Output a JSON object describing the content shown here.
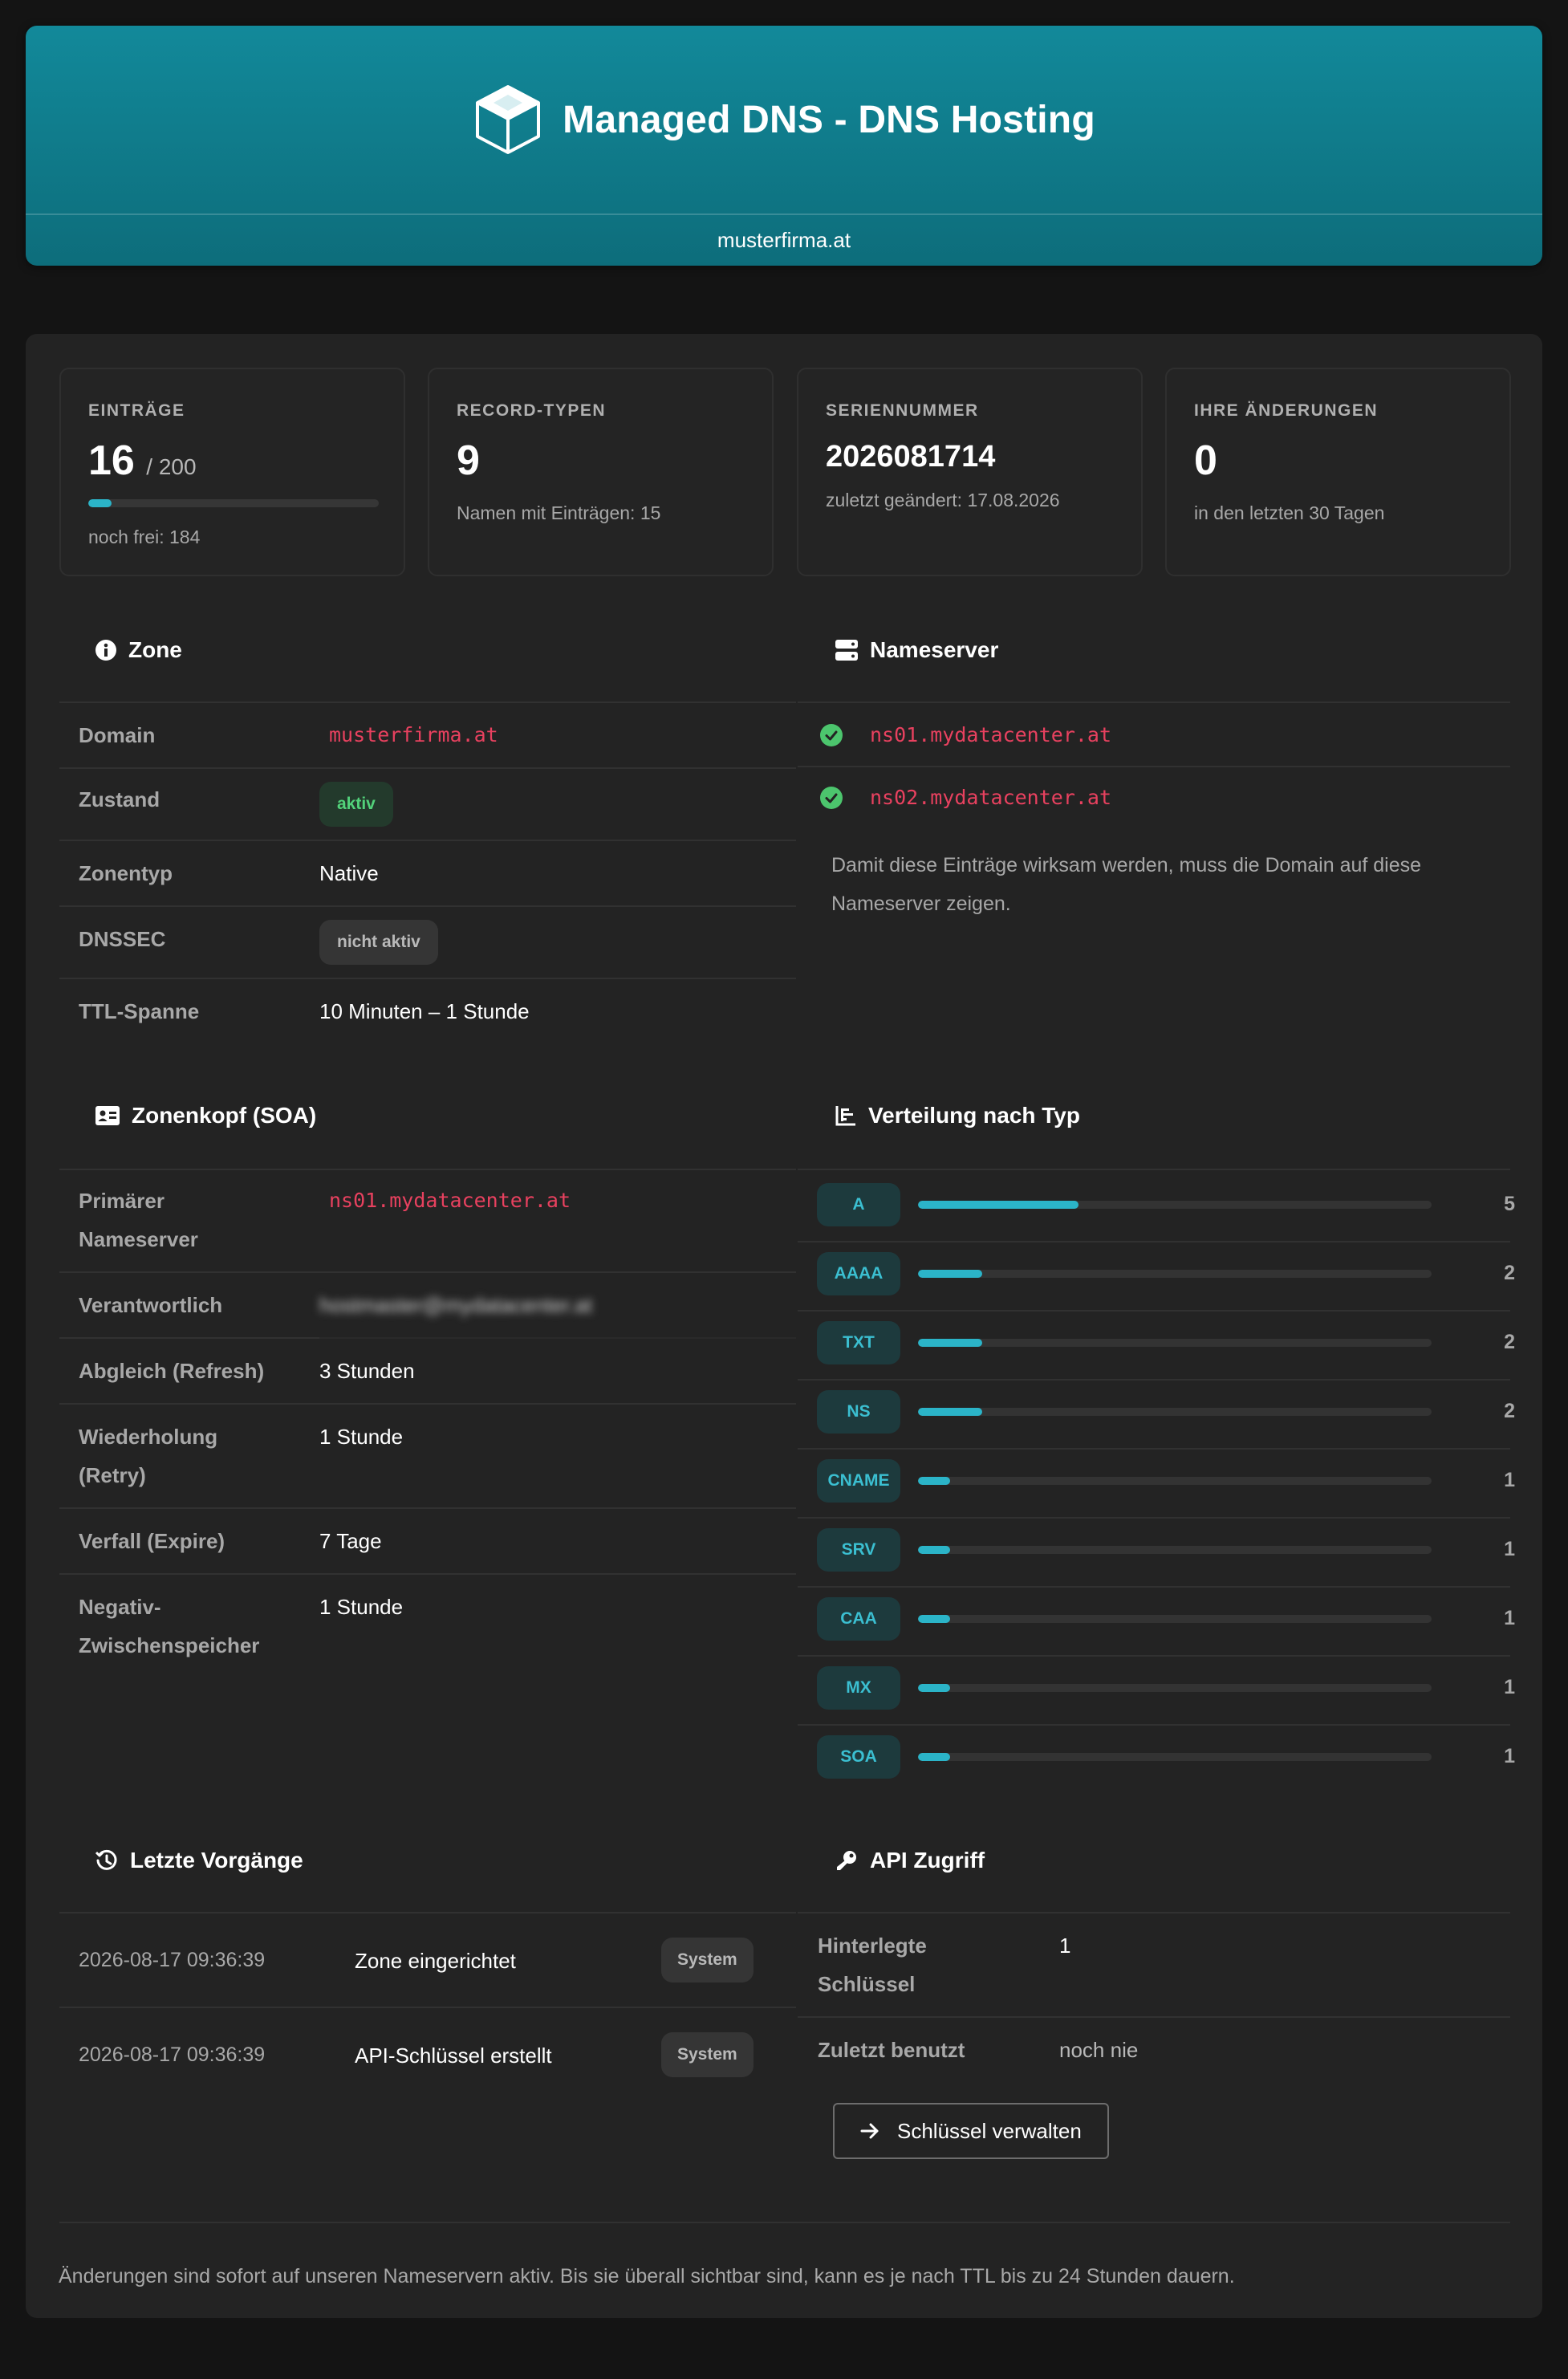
{
  "header": {
    "title": "Managed DNS - DNS Hosting",
    "domain": "musterfirma.at"
  },
  "stats": {
    "entries": {
      "label": "EINTRÄGE",
      "value": "16",
      "of": "/ 200",
      "used_fraction": 0.08,
      "note": "noch frei: 184"
    },
    "record_types": {
      "label": "RECORD-TYPEN",
      "value": "9",
      "note": "Namen mit Einträgen: 15"
    },
    "serial": {
      "label": "SERIENNUMMER",
      "value": "2026081714",
      "note": "zuletzt geändert: 17.08.2026"
    },
    "changes": {
      "label": "IHRE ÄNDERUNGEN",
      "value": "0",
      "note": "in den letzten 30 Tagen"
    }
  },
  "zone": {
    "title": "Zone",
    "rows": {
      "domain": {
        "key": "Domain",
        "value": "musterfirma.at"
      },
      "state": {
        "key": "Zustand",
        "value": "aktiv"
      },
      "type": {
        "key": "Zonentyp",
        "value": "Native"
      },
      "dnssec": {
        "key": "DNSSEC",
        "value": "nicht aktiv"
      },
      "ttl": {
        "key": "TTL-Spanne",
        "value": "10 Minuten – 1 Stunde"
      }
    }
  },
  "nameserver": {
    "title": "Nameserver",
    "servers": [
      "ns01.mydatacenter.at",
      "ns02.mydatacenter.at"
    ],
    "note_line1": "Damit diese Einträge wirksam werden, muss die Domain auf diese",
    "note_line2": "Nameserver zeigen."
  },
  "soa": {
    "title": "Zonenkopf (SOA)",
    "primary": {
      "key1": "Primärer",
      "key2": "Nameserver",
      "value": "ns01.mydatacenter.at"
    },
    "responsible": {
      "key": "Verantwortlich",
      "value": "hostmaster@mydatacenter.at"
    },
    "refresh": {
      "key": "Abgleich (Refresh)",
      "value": "3 Stunden"
    },
    "retry": {
      "key1": "Wiederholung",
      "key2": "(Retry)",
      "value": "1 Stunde"
    },
    "expire": {
      "key": "Verfall (Expire)",
      "value": "7 Tage"
    },
    "negative": {
      "key1": "Negativ-",
      "key2": "Zwischenspeicher",
      "value": "1 Stunde"
    }
  },
  "distribution": {
    "title": "Verteilung nach Typ",
    "max": 16,
    "items": [
      {
        "type": "A",
        "count": 5
      },
      {
        "type": "AAAA",
        "count": 2
      },
      {
        "type": "TXT",
        "count": 2
      },
      {
        "type": "NS",
        "count": 2
      },
      {
        "type": "CNAME",
        "count": 1
      },
      {
        "type": "SRV",
        "count": 1
      },
      {
        "type": "CAA",
        "count": 1
      },
      {
        "type": "MX",
        "count": 1
      },
      {
        "type": "SOA",
        "count": 1
      }
    ]
  },
  "recent": {
    "title": "Letzte Vorgänge",
    "events": [
      {
        "time": "2026-08-17 09:36:39",
        "text": "Zone eingerichtet",
        "tag": "System"
      },
      {
        "time": "2026-08-17 09:36:39",
        "text": "API-Schlüssel erstellt",
        "tag": "System"
      }
    ]
  },
  "api": {
    "title": "API Zugriff",
    "keys": {
      "key1": "Hinterlegte",
      "key2": "Schlüssel",
      "value": "1"
    },
    "last_used": {
      "key": "Zuletzt benutzt",
      "value": "noch nie"
    },
    "button": "Schlüssel verwalten"
  },
  "footer": {
    "note": "Änderungen sind sofort auf unseren Nameservern aktiv. Bis sie überall sichtbar sind, kann es je nach TTL bis zu 24 Stunden dauern."
  },
  "colors": {
    "accent": "#2bb4c8",
    "ok": "#52d27a",
    "mono": "#e8415f"
  }
}
